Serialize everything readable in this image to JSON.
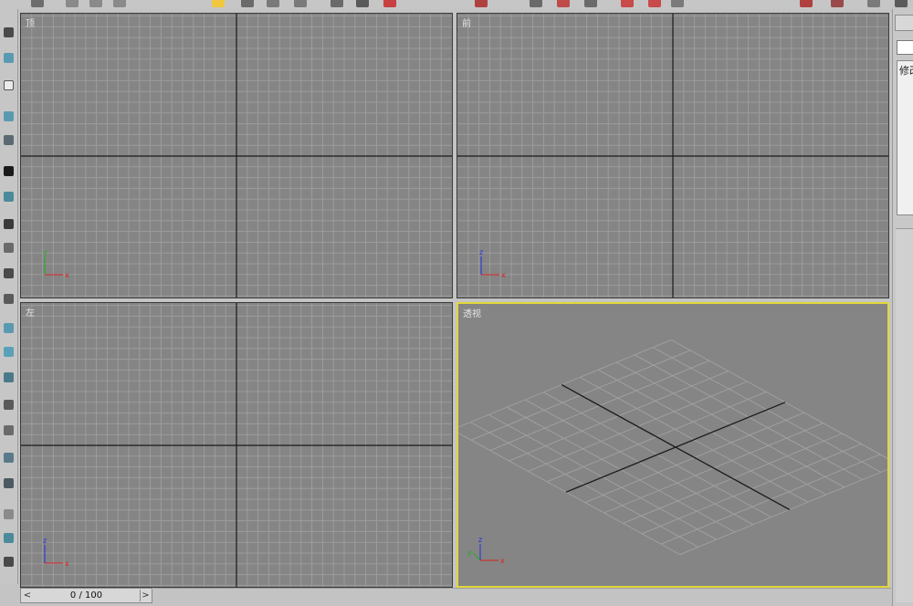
{
  "viewports": {
    "top": {
      "label": "顶"
    },
    "front": {
      "label": "前"
    },
    "left": {
      "label": "左"
    },
    "perspective": {
      "label": "透视"
    }
  },
  "axis_labels": {
    "x": "x",
    "y": "y",
    "z": "z"
  },
  "command_panel": {
    "modify_tab": "修改"
  },
  "time_slider": {
    "value": "0 / 100",
    "prev": "<",
    "next": ">"
  },
  "colors": {
    "viewport_bg": "#858585",
    "grid_line": "#9c9c9c",
    "major_axis": "#1a1a1a",
    "active_border": "#e2d73a",
    "axis_x": "#e02020",
    "axis_y": "#20b020",
    "axis_z": "#2030e0"
  }
}
